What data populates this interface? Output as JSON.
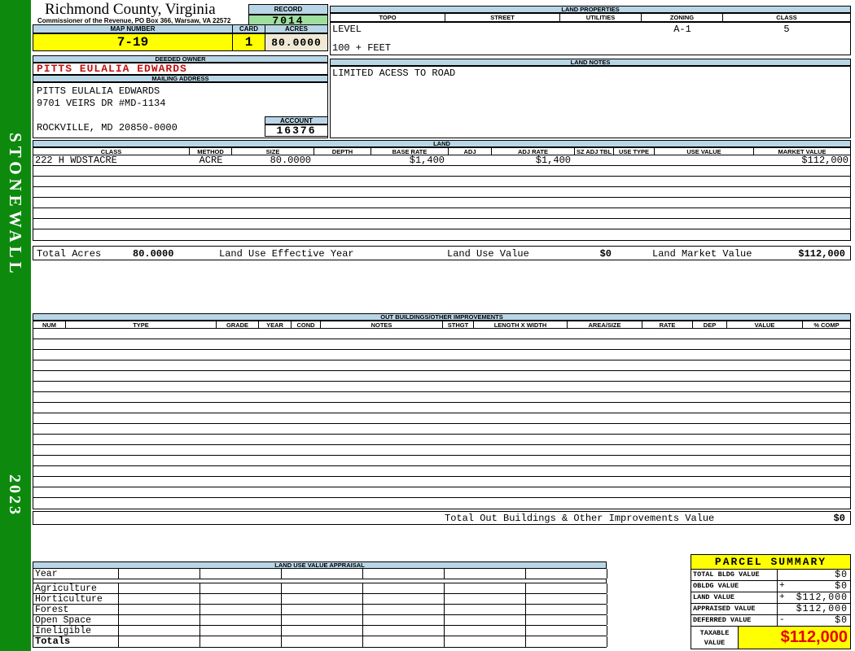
{
  "sidebar": {
    "district": "STONEWALL",
    "year": "2023"
  },
  "header": {
    "county_title": "Richmond County, Virginia",
    "commissioner_line": "Commissioner of the Revenue, PO Box 366, Warsaw, VA 22572",
    "record_label": "RECORD",
    "record_value": "7014",
    "map_number_label": "MAP NUMBER",
    "map_number_value": "7-19",
    "card_label": "CARD",
    "card_value": "1",
    "acres_label": "ACRES",
    "acres_value": "80.0000"
  },
  "land_properties": {
    "title": "LAND PROPERTIES",
    "columns": [
      "TOPO",
      "STREET",
      "UTILITIES",
      "ZONING",
      "CLASS"
    ],
    "topo_value": "LEVEL",
    "zoning_value": "A-1",
    "class_value": "5",
    "frontage_note": "100 + FEET"
  },
  "land_notes": {
    "title": "LAND NOTES",
    "note": "LIMITED ACESS TO ROAD"
  },
  "owner": {
    "deeded_owner_label": "DEEDED OWNER",
    "deeded_owner": "PITTS EULALIA EDWARDS",
    "mailing_address_label": "MAILING ADDRESS",
    "address_line1": "PITTS EULALIA EDWARDS",
    "address_line2": "9701 VEIRS DR #MD-1134",
    "address_line3": "ROCKVILLE, MD 20850-0000",
    "account_label": "ACCOUNT",
    "account_value": "16376"
  },
  "land_table": {
    "title": "LAND",
    "columns": [
      "CLASS",
      "METHOD",
      "SIZE",
      "DEPTH",
      "BASE RATE",
      "ADJ",
      "ADJ RATE",
      "SZ ADJ TBL",
      "USE TYPE",
      "USE VALUE",
      "MARKET VALUE"
    ],
    "rows": [
      {
        "class": "222 H WDSTACRE",
        "method": "ACRE",
        "size": "80.0000",
        "base_rate": "$1,400",
        "adj_rate": "$1,400",
        "market_value": "$112,000"
      }
    ],
    "totals": {
      "total_acres_label": "Total Acres",
      "total_acres": "80.0000",
      "effective_year_label": "Land Use Effective Year",
      "use_value_label": "Land Use Value",
      "use_value": "$0",
      "market_value_label": "Land Market Value",
      "market_value": "$112,000"
    }
  },
  "out_buildings": {
    "title": "OUT BUILDINGS/OTHER IMPROVEMENTS",
    "columns": [
      "NUM",
      "TYPE",
      "GRADE",
      "YEAR",
      "COND",
      "NOTES",
      "STHGT",
      "LENGTH X WIDTH",
      "AREA/SIZE",
      "RATE",
      "DEP",
      "VALUE",
      "% COMP"
    ],
    "total_label": "Total Out Buildings & Other Improvements Value",
    "total_value": "$0"
  },
  "land_use_appraisal": {
    "title": "LAND USE VALUE APPRAISAL",
    "row_labels": [
      "Year",
      "Agriculture",
      "Horticulture",
      "Forest",
      "Open Space",
      "Ineligible",
      "Totals"
    ]
  },
  "parcel_summary": {
    "title": "PARCEL SUMMARY",
    "rows": [
      {
        "label": "TOTAL BLDG VALUE",
        "op": "",
        "value": "$0"
      },
      {
        "label": "OBLDG VALUE",
        "op": "+",
        "value": "$0"
      },
      {
        "label": "LAND VALUE",
        "op": "+",
        "value": "$112,000"
      },
      {
        "label": "APPRAISED VALUE",
        "op": "",
        "value": "$112,000"
      },
      {
        "label": "DEFERRED VALUE",
        "op": "-",
        "value": "$0"
      }
    ],
    "taxable_label": "TAXABLE VALUE",
    "taxable_value": "$112,000"
  },
  "colors": {
    "sidebar_green": "#0d8a0d",
    "header_blue": "#b9d6e7",
    "record_green": "#9edf9e",
    "highlight_yellow": "#ffff00",
    "acres_cream": "#efe9d6",
    "owner_red": "#c41111",
    "taxable_red": "#e80000"
  }
}
